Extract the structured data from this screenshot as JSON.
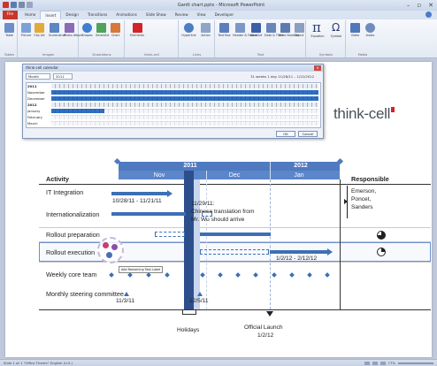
{
  "window": {
    "title": "Gantt chart.pptx - Microsoft PowerPoint",
    "controls": [
      "–",
      "▫",
      "✕"
    ]
  },
  "ribbon": {
    "file_tab": "File",
    "tabs": [
      "Home",
      "Insert",
      "Design",
      "Transitions",
      "Animations",
      "Slide Show",
      "Review",
      "View",
      "Developer"
    ],
    "active_tab": "Insert",
    "groups": [
      "Tables",
      "Images",
      "Illustrations",
      "think-cell",
      "Links",
      "Text",
      "Symbols",
      "Media"
    ],
    "buttons": [
      "Table",
      "Picture",
      "Clip Art",
      "Screenshot",
      "Photo Album",
      "Shapes",
      "SmartArt",
      "Chart",
      "Elements",
      "Hyperlink",
      "Action",
      "Text Box",
      "Header & Footer",
      "WordArt",
      "Date & Time",
      "Slide Number",
      "Object",
      "Equation",
      "Symbol",
      "Video",
      "Audio"
    ],
    "colors": {
      "file_tab": "#c8372c",
      "ribbon_bg": "#f6f8fc"
    }
  },
  "status_bar": {
    "left": "Slide 1 of 1   \"Office Theme\"   English (U.S.)",
    "zoom": "77%"
  },
  "logo": {
    "text": "think-cell"
  },
  "dialog": {
    "title": "think-cell calendar",
    "close": "x",
    "view_select": "Month",
    "year_select": "2011",
    "info": "31 weeks   1 day   11/28/11 – 1/22/2012",
    "rows": [
      {
        "label": "2011",
        "kind": "year"
      },
      {
        "label": "November",
        "kind": "month",
        "selected": true
      },
      {
        "label": "December",
        "kind": "month",
        "selected": true
      },
      {
        "label": "2012",
        "kind": "year"
      },
      {
        "label": "January",
        "kind": "month",
        "selected": true
      },
      {
        "label": "February",
        "kind": "month",
        "selected": false
      },
      {
        "label": "March",
        "kind": "month",
        "selected": false
      }
    ],
    "ok": "OK",
    "cancel": "Cancel"
  },
  "gantt": {
    "years": [
      "2011",
      "2012"
    ],
    "months": [
      "Nov",
      "Dec",
      "Jan"
    ],
    "col_activity": "Activity",
    "col_responsible": "Responsible",
    "activities": [
      "IT Integration",
      "Internationalization",
      "Rollout preparation",
      "Rollout execution",
      "Weekly core team",
      "Monthly steering committee"
    ],
    "labels": {
      "it_range": "10/28/11 - 11/21/11",
      "note_date": "11/29/11:",
      "note_text_1": "Chinese translation from",
      "note_text_2": "Mr. Wu should arrive",
      "rollout_exec_range": "1/2/12 - 2/12/12",
      "steering_1": "11/3/11",
      "steering_2": "12/5/11",
      "holidays": "Holidays",
      "launch_1": "Official Launch",
      "launch_2": "1/2/12",
      "tooltip": "Add Remaining Task Label"
    },
    "responsible": [
      "Emerson,",
      "Poncet,",
      "Sanders"
    ],
    "colors": {
      "header": "#4f7ac0",
      "bar": "#3d6fb6",
      "holiday": "#2c4f8c"
    }
  }
}
